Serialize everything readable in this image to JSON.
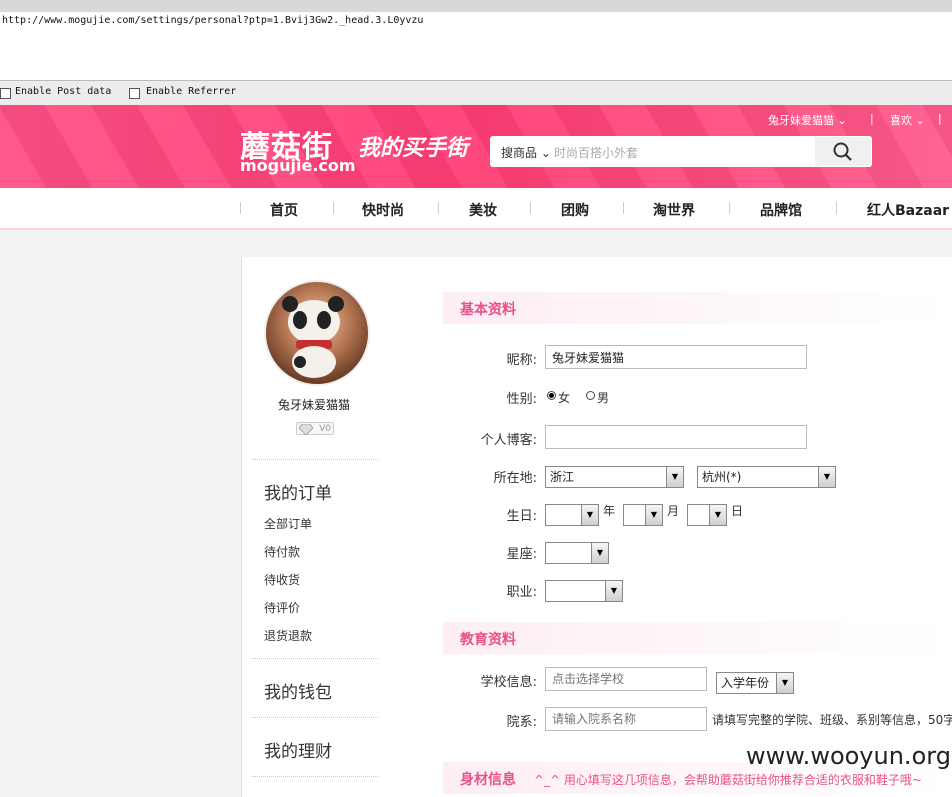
{
  "browser": {
    "url": "http://www.mogujie.com/settings/personal?ptp=1.Bvij3Gw2._head.3.L0yvzu",
    "enable_post_data": "Enable Post data",
    "enable_referrer": "Enable Referrer"
  },
  "header": {
    "logo_main": "蘑菇街",
    "logo_sub": "mogujie.com",
    "slogan": "我的买手街",
    "search_category": "搜商品",
    "search_placeholder": "时尚百搭小外套",
    "user_name": "兔牙妹爱猫猫",
    "favorites": "喜欢",
    "separator": "|"
  },
  "nav": {
    "items": [
      "首页",
      "快时尚",
      "美妆",
      "团购",
      "淘世界",
      "品牌馆",
      "红人Bazaar"
    ]
  },
  "sidebar": {
    "username": "兔牙妹爱猫猫",
    "vip": "V0",
    "orders_title": "我的订单",
    "order_links": [
      "全部订单",
      "待付款",
      "待收货",
      "待评价",
      "退货退款"
    ],
    "wallet": "我的钱包",
    "finance": "我的理财"
  },
  "form": {
    "basic_title": "基本资料",
    "nickname_label": "昵称:",
    "nickname_value": "兔牙妹爱猫猫",
    "gender_label": "性别:",
    "gender_female": "女",
    "gender_male": "男",
    "blog_label": "个人博客:",
    "location_label": "所在地:",
    "province": "浙江",
    "city": "杭州(*)",
    "birthday_label": "生日:",
    "year_unit": "年",
    "month_unit": "月",
    "day_unit": "日",
    "zodiac_label": "星座:",
    "job_label": "职业:",
    "edu_title": "教育资料",
    "school_label": "学校信息:",
    "school_placeholder": "点击选择学校",
    "entry_year": "入学年份",
    "dept_label": "院系:",
    "dept_placeholder": "请输入院系名称",
    "dept_hint": "请填写完整的学院、班级、系别等信息，50字",
    "body_title": "身材信息",
    "body_note": "^_^ 用心填写这几项信息，会帮助蘑菇街给你推荐合适的衣服和鞋子哦~"
  },
  "watermark": "www.wooyun.org"
}
